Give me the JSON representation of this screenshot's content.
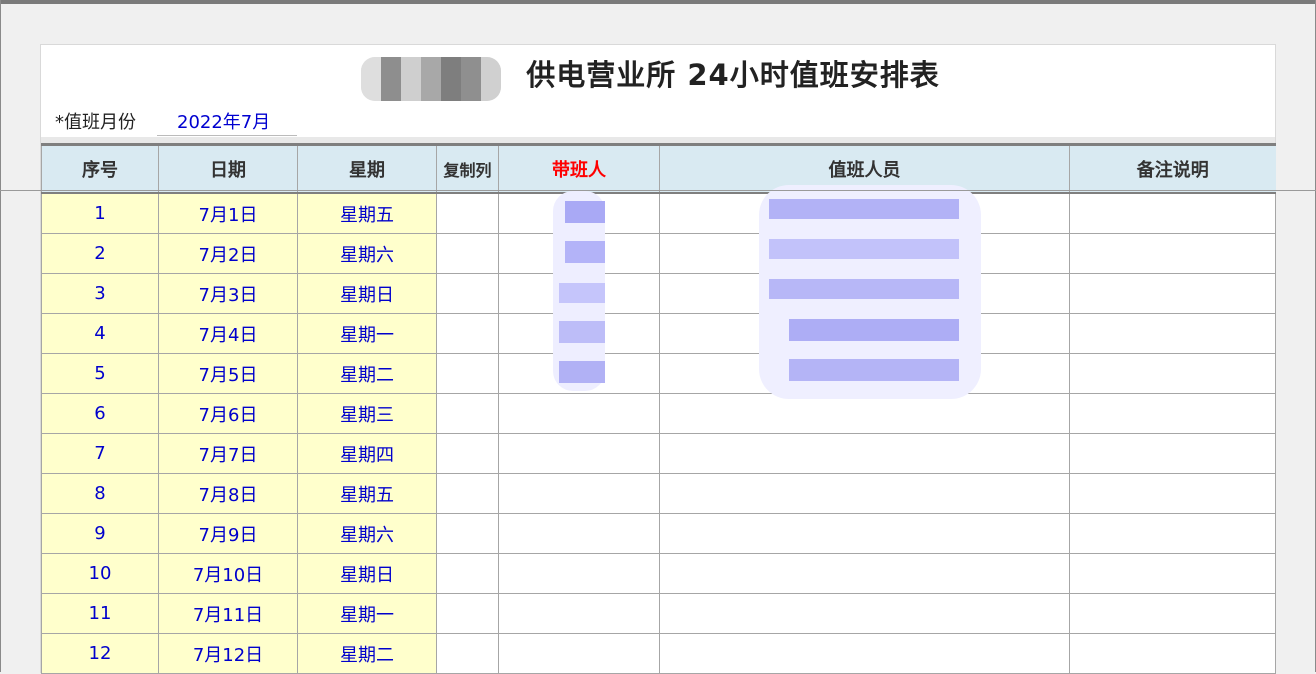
{
  "header": {
    "title": "供电营业所  24小时值班安排表",
    "month_label": "*值班月份",
    "month_value": "2022年7月"
  },
  "table": {
    "columns": [
      "序号",
      "日期",
      "星期",
      "复制列",
      "带班人",
      "值班人员",
      "备注说明"
    ],
    "rows": [
      [
        "1",
        "7月1日",
        "星期五"
      ],
      [
        "2",
        "7月2日",
        "星期六"
      ],
      [
        "3",
        "7月3日",
        "星期日"
      ],
      [
        "4",
        "7月4日",
        "星期一"
      ],
      [
        "5",
        "7月5日",
        "星期二"
      ],
      [
        "6",
        "7月6日",
        "星期三"
      ],
      [
        "7",
        "7月7日",
        "星期四"
      ],
      [
        "8",
        "7月8日",
        "星期五"
      ],
      [
        "9",
        "7月9日",
        "星期六"
      ],
      [
        "10",
        "7月10日",
        "星期日"
      ],
      [
        "11",
        "7月11日",
        "星期一"
      ],
      [
        "12",
        "7月12日",
        "星期二"
      ]
    ]
  },
  "colors": {
    "header_bg": "#d9eaf2",
    "frozen_col_bg": "#ffffcc",
    "cell_text": "#0000cc",
    "leader_header": "#ff0000"
  }
}
